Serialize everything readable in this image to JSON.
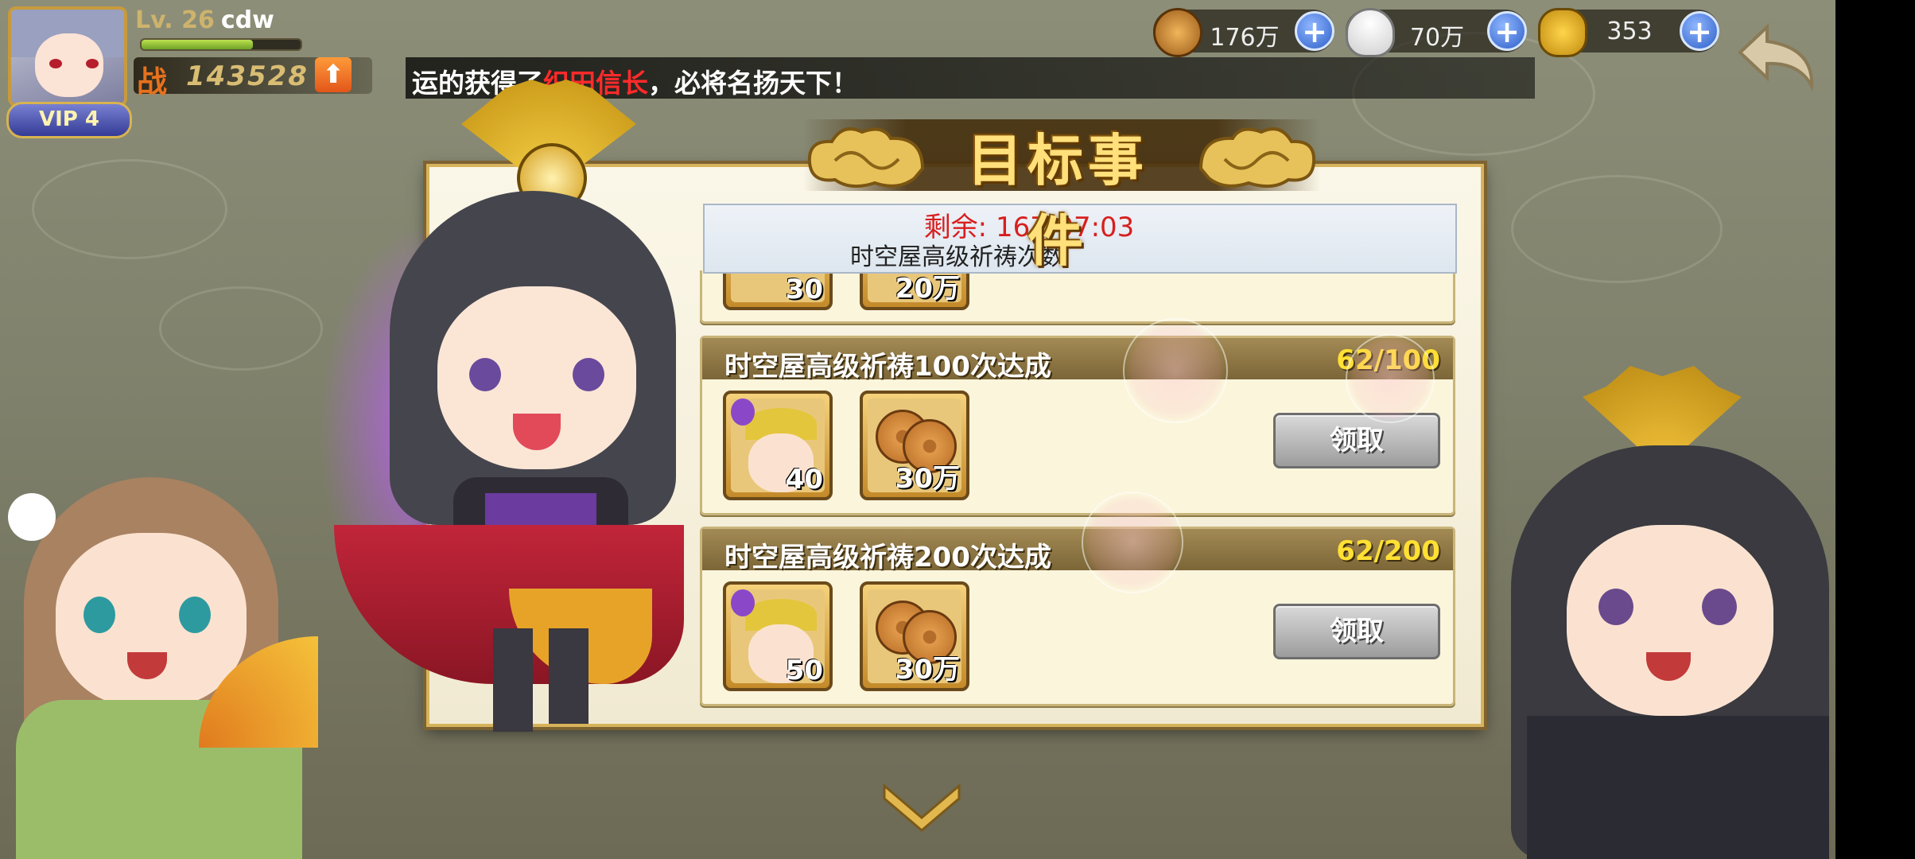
{
  "player": {
    "level_prefix": "Lv. 26",
    "name": "cdw",
    "exp_fraction": 0.7,
    "power_label": "战",
    "power_value": "143528",
    "vip_label": "VIP 4"
  },
  "currencies": [
    {
      "icon": "copper-coin-icon",
      "value": "176万"
    },
    {
      "icon": "rice-ball-icon",
      "value": "70万"
    },
    {
      "icon": "gold-koban-icon",
      "value": "353"
    }
  ],
  "marquee": {
    "before": "运的获得了",
    "highlight": "织田信长",
    "after": "，必将名扬天下！"
  },
  "panel": {
    "title": "目标事件",
    "timer_label": "剩余:",
    "timer_value": "167:07:03",
    "subtitle": "时空屋高级祈祷次数"
  },
  "partial_rewards": [
    "30",
    "20万"
  ],
  "tasks": [
    {
      "title": "时空屋高级祈祷100次达成",
      "progress": "62/100",
      "rewards": [
        {
          "icon": "ninja-ticket-icon",
          "count": "40"
        },
        {
          "icon": "copper-coin-icon",
          "count": "30万"
        }
      ],
      "claim_label": "领取"
    },
    {
      "title": "时空屋高级祈祷200次达成",
      "progress": "62/200",
      "rewards": [
        {
          "icon": "ninja-ticket-icon",
          "count": "50"
        },
        {
          "icon": "copper-coin-icon",
          "count": "30万"
        }
      ],
      "claim_label": "领取"
    }
  ],
  "colors": {
    "accent_gold": "#ffe07a",
    "timer_red": "#d81f1f",
    "progress_yellow": "#ffe033",
    "marquee_highlight": "#ff2a2a"
  }
}
